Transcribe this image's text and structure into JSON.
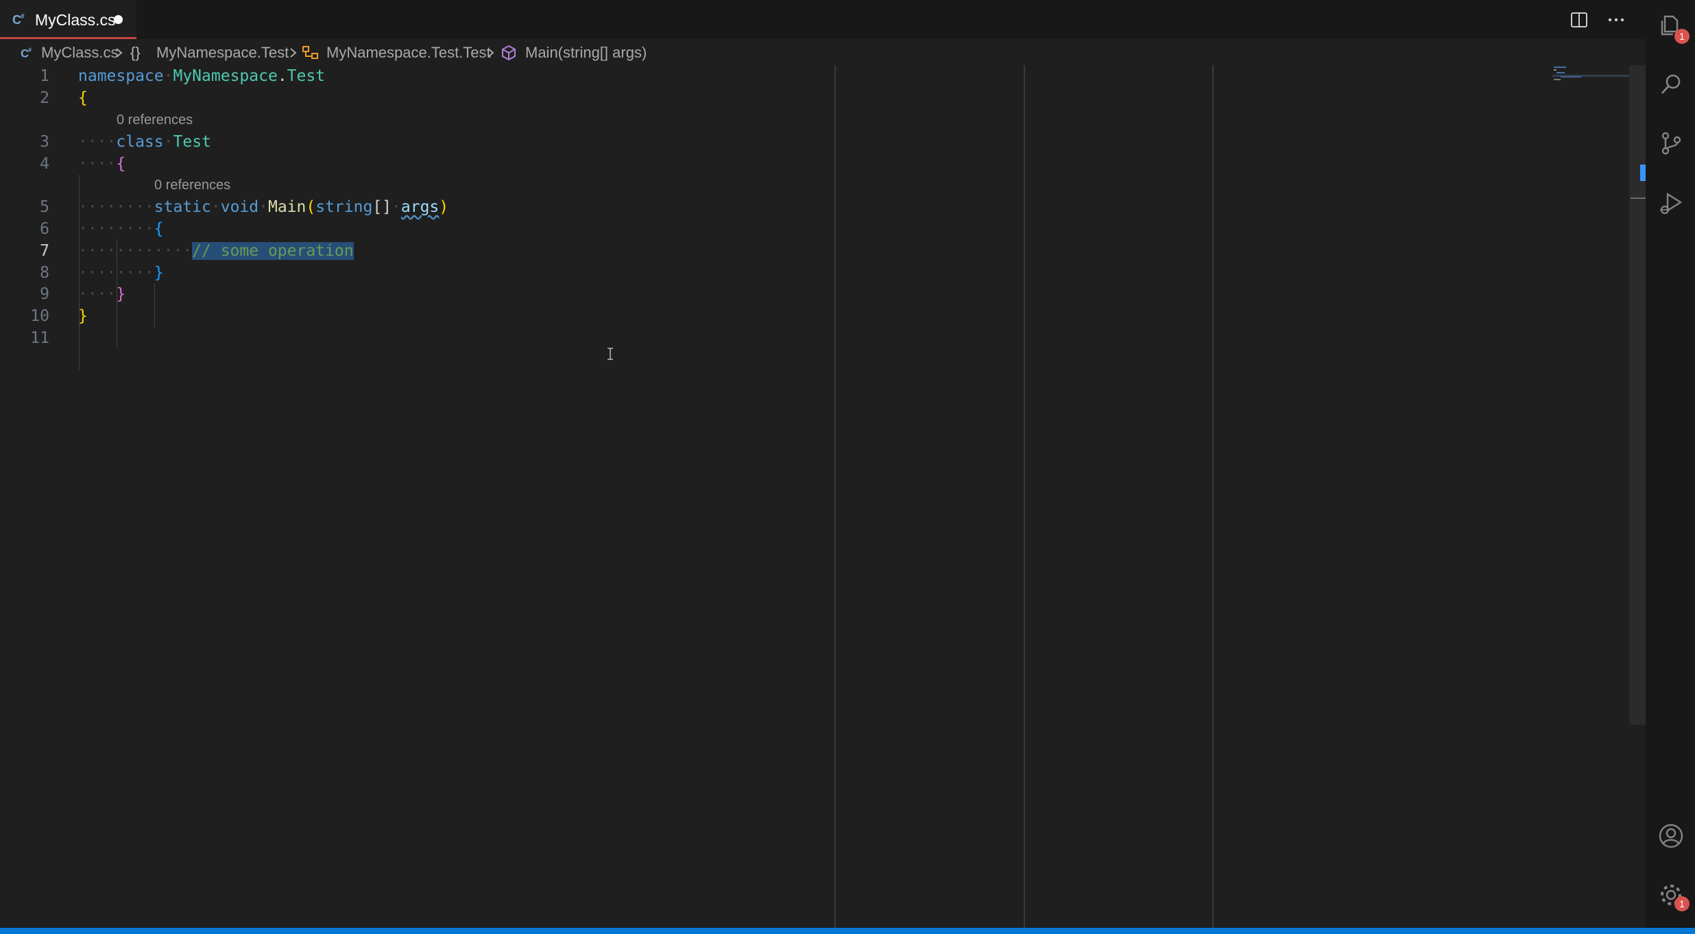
{
  "tab": {
    "title": "MyClass.cs",
    "dirty": true
  },
  "toolbar": {
    "split_icon": "split-editor-icon",
    "more_icon": "more-actions-icon"
  },
  "breadcrumb": {
    "file": "MyClass.cs",
    "namespace": "MyNamespace.Test",
    "class": "MyNamespace.Test.Test",
    "method": "Main(string[] args)"
  },
  "editor": {
    "line_numbers": [
      "1",
      "2",
      "3",
      "4",
      "5",
      "6",
      "7",
      "8",
      "9",
      "10",
      "11"
    ],
    "codelens": [
      "0 references",
      "0 references"
    ],
    "tokens": {
      "namespace_kw": "namespace",
      "namespace_name": "MyNamespace",
      "dot": ".",
      "namespace_last": "Test",
      "class_kw": "class",
      "class_name": "Test",
      "static_kw": "static",
      "void_kw": "void",
      "method_name": "Main",
      "string_kw": "string",
      "array_brackets": "[]",
      "param_name": "args",
      "comment": "// some operation",
      "open_brace": "{",
      "close_brace": "}",
      "open_paren": "(",
      "close_paren": ")"
    }
  },
  "activity_bar": {
    "explorer_badge": "1",
    "manage_badge": "1",
    "icons": [
      "explorer-icon",
      "search-icon",
      "source-control-icon",
      "run-debug-icon",
      "accounts-icon",
      "manage-gear-icon"
    ]
  },
  "colors": {
    "background": "#1f1f1f",
    "tab_active_border": "#c4453f",
    "status_bar": "#0078d4",
    "keyword": "#569cd6",
    "type": "#4ec9b0",
    "function": "#dcdcaa",
    "comment": "#6a9955",
    "selection": "#264f78"
  }
}
